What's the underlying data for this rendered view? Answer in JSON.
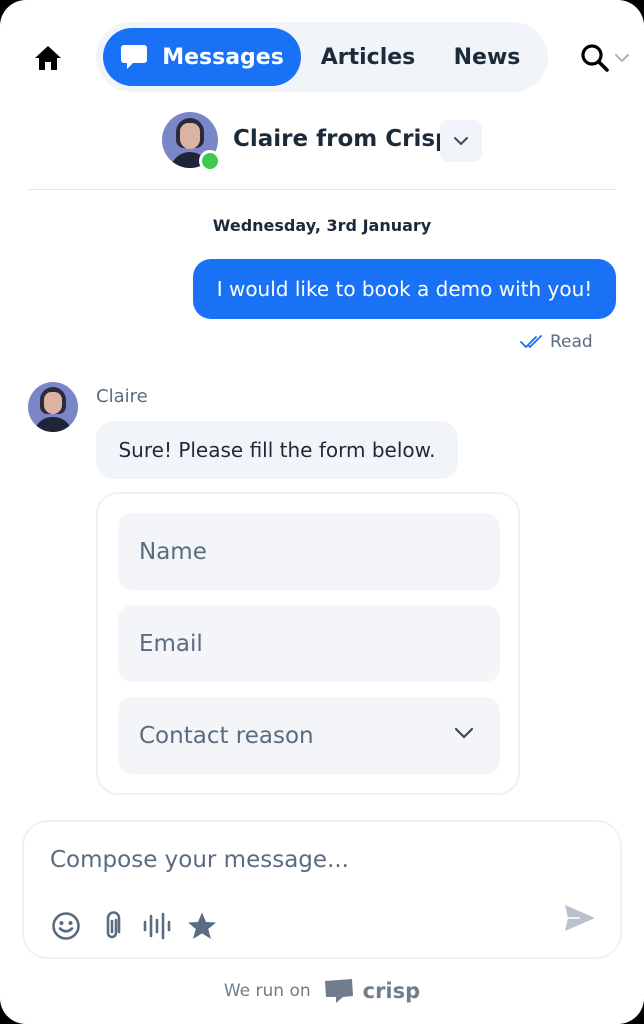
{
  "nav": {
    "tabs": [
      {
        "label": "Messages",
        "active": true
      },
      {
        "label": "Articles",
        "active": false
      },
      {
        "label": "News",
        "active": false
      }
    ]
  },
  "agent": {
    "name": "Claire from Crisp",
    "status": "online"
  },
  "conversation": {
    "date": "Wednesday, 3rd January",
    "user_message": "I would like to book a demo with you!",
    "read_status": "Read",
    "sender": "Claire",
    "agent_message": "Sure! Please fill the form below."
  },
  "form": {
    "name_placeholder": "Name",
    "email_placeholder": "Email",
    "reason_placeholder": "Contact reason"
  },
  "composer": {
    "placeholder": "Compose your message..."
  },
  "footer": {
    "text": "We run on",
    "brand": "crisp"
  },
  "colors": {
    "accent": "#1972f5",
    "online": "#3ec94f",
    "text": "#1c2b3a",
    "muted": "#5a6c80",
    "surface": "#f1f4f8"
  },
  "icons": [
    "home-icon",
    "chat-bubble-icon",
    "search-icon",
    "chevron-down-icon",
    "double-check-icon",
    "emoji-icon",
    "paperclip-icon",
    "voice-icon",
    "star-icon",
    "send-icon",
    "crisp-logo-icon"
  ]
}
